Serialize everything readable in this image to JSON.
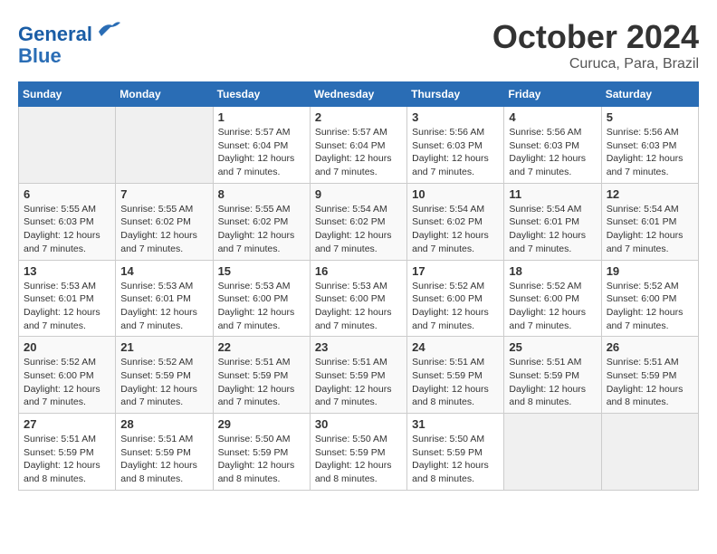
{
  "header": {
    "logo_line1": "General",
    "logo_line2": "Blue",
    "month": "October 2024",
    "location": "Curuca, Para, Brazil"
  },
  "weekdays": [
    "Sunday",
    "Monday",
    "Tuesday",
    "Wednesday",
    "Thursday",
    "Friday",
    "Saturday"
  ],
  "weeks": [
    [
      {
        "day": "",
        "info": ""
      },
      {
        "day": "",
        "info": ""
      },
      {
        "day": "1",
        "info": "Sunrise: 5:57 AM\nSunset: 6:04 PM\nDaylight: 12 hours\nand 7 minutes."
      },
      {
        "day": "2",
        "info": "Sunrise: 5:57 AM\nSunset: 6:04 PM\nDaylight: 12 hours\nand 7 minutes."
      },
      {
        "day": "3",
        "info": "Sunrise: 5:56 AM\nSunset: 6:03 PM\nDaylight: 12 hours\nand 7 minutes."
      },
      {
        "day": "4",
        "info": "Sunrise: 5:56 AM\nSunset: 6:03 PM\nDaylight: 12 hours\nand 7 minutes."
      },
      {
        "day": "5",
        "info": "Sunrise: 5:56 AM\nSunset: 6:03 PM\nDaylight: 12 hours\nand 7 minutes."
      }
    ],
    [
      {
        "day": "6",
        "info": "Sunrise: 5:55 AM\nSunset: 6:03 PM\nDaylight: 12 hours\nand 7 minutes."
      },
      {
        "day": "7",
        "info": "Sunrise: 5:55 AM\nSunset: 6:02 PM\nDaylight: 12 hours\nand 7 minutes."
      },
      {
        "day": "8",
        "info": "Sunrise: 5:55 AM\nSunset: 6:02 PM\nDaylight: 12 hours\nand 7 minutes."
      },
      {
        "day": "9",
        "info": "Sunrise: 5:54 AM\nSunset: 6:02 PM\nDaylight: 12 hours\nand 7 minutes."
      },
      {
        "day": "10",
        "info": "Sunrise: 5:54 AM\nSunset: 6:02 PM\nDaylight: 12 hours\nand 7 minutes."
      },
      {
        "day": "11",
        "info": "Sunrise: 5:54 AM\nSunset: 6:01 PM\nDaylight: 12 hours\nand 7 minutes."
      },
      {
        "day": "12",
        "info": "Sunrise: 5:54 AM\nSunset: 6:01 PM\nDaylight: 12 hours\nand 7 minutes."
      }
    ],
    [
      {
        "day": "13",
        "info": "Sunrise: 5:53 AM\nSunset: 6:01 PM\nDaylight: 12 hours\nand 7 minutes."
      },
      {
        "day": "14",
        "info": "Sunrise: 5:53 AM\nSunset: 6:01 PM\nDaylight: 12 hours\nand 7 minutes."
      },
      {
        "day": "15",
        "info": "Sunrise: 5:53 AM\nSunset: 6:00 PM\nDaylight: 12 hours\nand 7 minutes."
      },
      {
        "day": "16",
        "info": "Sunrise: 5:53 AM\nSunset: 6:00 PM\nDaylight: 12 hours\nand 7 minutes."
      },
      {
        "day": "17",
        "info": "Sunrise: 5:52 AM\nSunset: 6:00 PM\nDaylight: 12 hours\nand 7 minutes."
      },
      {
        "day": "18",
        "info": "Sunrise: 5:52 AM\nSunset: 6:00 PM\nDaylight: 12 hours\nand 7 minutes."
      },
      {
        "day": "19",
        "info": "Sunrise: 5:52 AM\nSunset: 6:00 PM\nDaylight: 12 hours\nand 7 minutes."
      }
    ],
    [
      {
        "day": "20",
        "info": "Sunrise: 5:52 AM\nSunset: 6:00 PM\nDaylight: 12 hours\nand 7 minutes."
      },
      {
        "day": "21",
        "info": "Sunrise: 5:52 AM\nSunset: 5:59 PM\nDaylight: 12 hours\nand 7 minutes."
      },
      {
        "day": "22",
        "info": "Sunrise: 5:51 AM\nSunset: 5:59 PM\nDaylight: 12 hours\nand 7 minutes."
      },
      {
        "day": "23",
        "info": "Sunrise: 5:51 AM\nSunset: 5:59 PM\nDaylight: 12 hours\nand 7 minutes."
      },
      {
        "day": "24",
        "info": "Sunrise: 5:51 AM\nSunset: 5:59 PM\nDaylight: 12 hours\nand 8 minutes."
      },
      {
        "day": "25",
        "info": "Sunrise: 5:51 AM\nSunset: 5:59 PM\nDaylight: 12 hours\nand 8 minutes."
      },
      {
        "day": "26",
        "info": "Sunrise: 5:51 AM\nSunset: 5:59 PM\nDaylight: 12 hours\nand 8 minutes."
      }
    ],
    [
      {
        "day": "27",
        "info": "Sunrise: 5:51 AM\nSunset: 5:59 PM\nDaylight: 12 hours\nand 8 minutes."
      },
      {
        "day": "28",
        "info": "Sunrise: 5:51 AM\nSunset: 5:59 PM\nDaylight: 12 hours\nand 8 minutes."
      },
      {
        "day": "29",
        "info": "Sunrise: 5:50 AM\nSunset: 5:59 PM\nDaylight: 12 hours\nand 8 minutes."
      },
      {
        "day": "30",
        "info": "Sunrise: 5:50 AM\nSunset: 5:59 PM\nDaylight: 12 hours\nand 8 minutes."
      },
      {
        "day": "31",
        "info": "Sunrise: 5:50 AM\nSunset: 5:59 PM\nDaylight: 12 hours\nand 8 minutes."
      },
      {
        "day": "",
        "info": ""
      },
      {
        "day": "",
        "info": ""
      }
    ]
  ]
}
